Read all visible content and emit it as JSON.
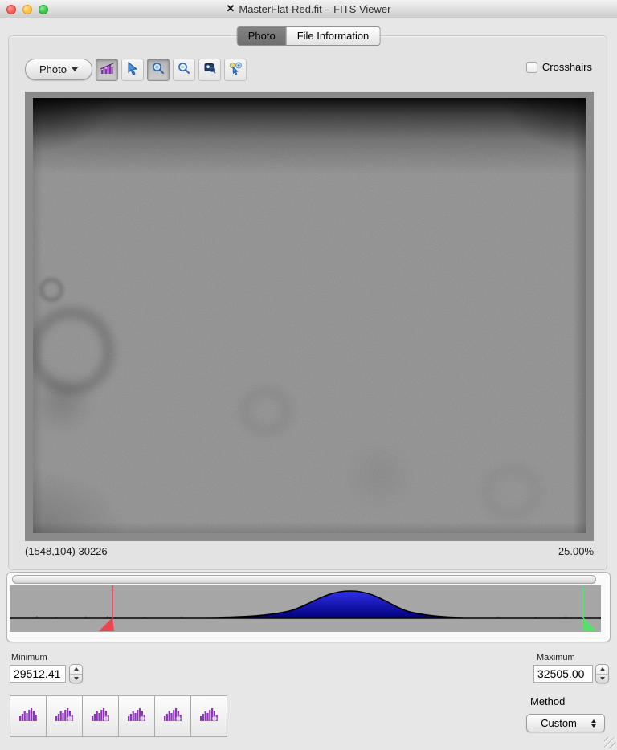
{
  "window": {
    "doc_icon": "✕",
    "title": "MasterFlat-Red.fit – FITS Viewer"
  },
  "tabs": {
    "photo": "Photo",
    "file_information": "File Information",
    "selected": "Photo"
  },
  "toolbar": {
    "photo_menu_label": "Photo",
    "crosshairs_label": "Crosshairs",
    "crosshairs_checked": false,
    "tools": [
      {
        "name": "histogram-tool",
        "pressed": true
      },
      {
        "name": "select-tool",
        "pressed": false
      },
      {
        "name": "zoom-in-tool",
        "pressed": true
      },
      {
        "name": "zoom-out-tool",
        "pressed": false
      },
      {
        "name": "zoom-actual-tool",
        "pressed": false
      },
      {
        "name": "zoom-selection-tool",
        "pressed": false
      }
    ]
  },
  "status": {
    "cursor_readout": "(1548,104) 30226",
    "zoom_level": "25.00%"
  },
  "histogram": {
    "curve_color": "#1a1ad0",
    "min_marker_color": "#ee4450",
    "max_marker_color": "#55e06a",
    "min_marker_value": "29512.41",
    "max_marker_value": "32505.00",
    "peak_position_fraction": 0.58
  },
  "controls": {
    "minimum_label": "Minimum",
    "minimum_value": "29512.41",
    "maximum_label": "Maximum",
    "maximum_value": "32505.00",
    "method_label": "Method",
    "method_value": "Custom",
    "preset_count": 6
  }
}
